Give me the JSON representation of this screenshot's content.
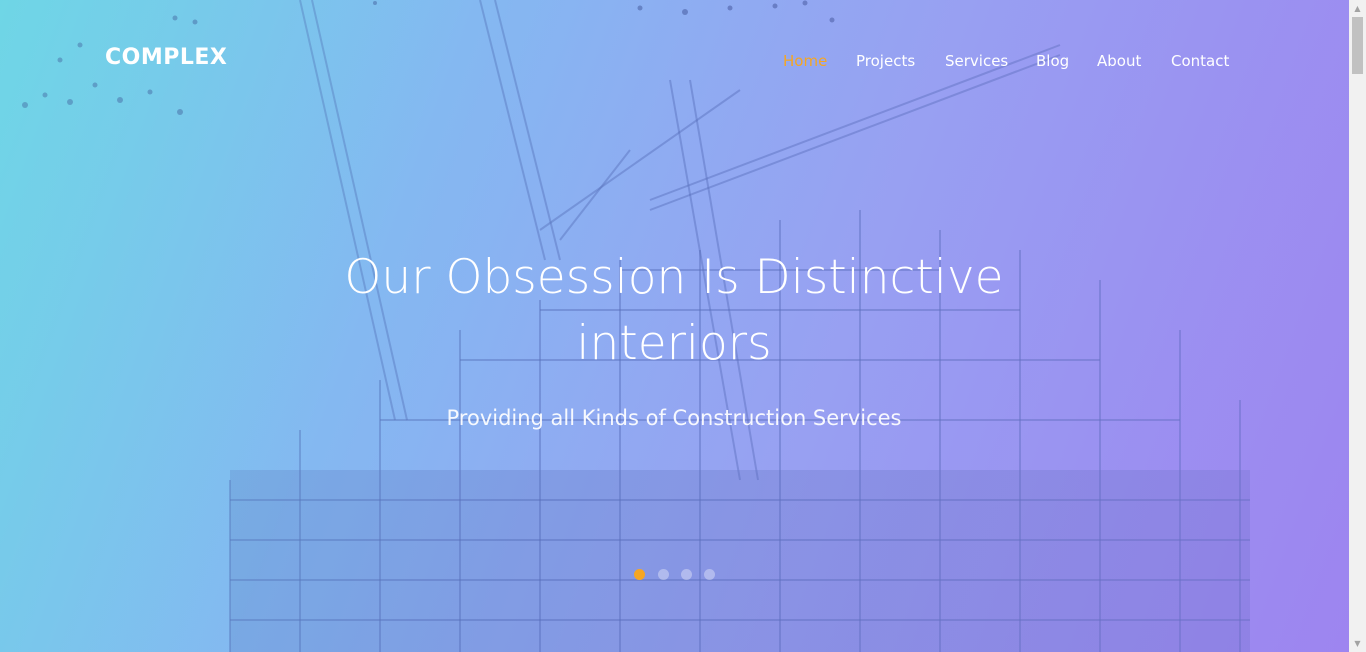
{
  "brand": {
    "logo_text": "COMPLEX"
  },
  "nav": {
    "items": [
      {
        "label": "Home",
        "active": true
      },
      {
        "label": "Projects",
        "active": false
      },
      {
        "label": "Services",
        "active": false
      },
      {
        "label": "Blog",
        "active": false
      },
      {
        "label": "About",
        "active": false
      },
      {
        "label": "Contact",
        "active": false
      }
    ]
  },
  "hero": {
    "headline_line1": "Our Obsession Is Distinctive",
    "headline_line2": "interiors",
    "subtitle": "Providing all Kinds of Construction Services",
    "background_image": "construction-site-cranes",
    "slider": {
      "count": 4,
      "active_index": 0
    }
  },
  "colors": {
    "accent": "#f5a623",
    "text": "#ffffff",
    "gradient_start": "#6fd6e6",
    "gradient_end": "#9c86f0"
  },
  "icons": {
    "scroll_up": "scroll-up-icon",
    "scroll_down": "scroll-down-icon"
  }
}
